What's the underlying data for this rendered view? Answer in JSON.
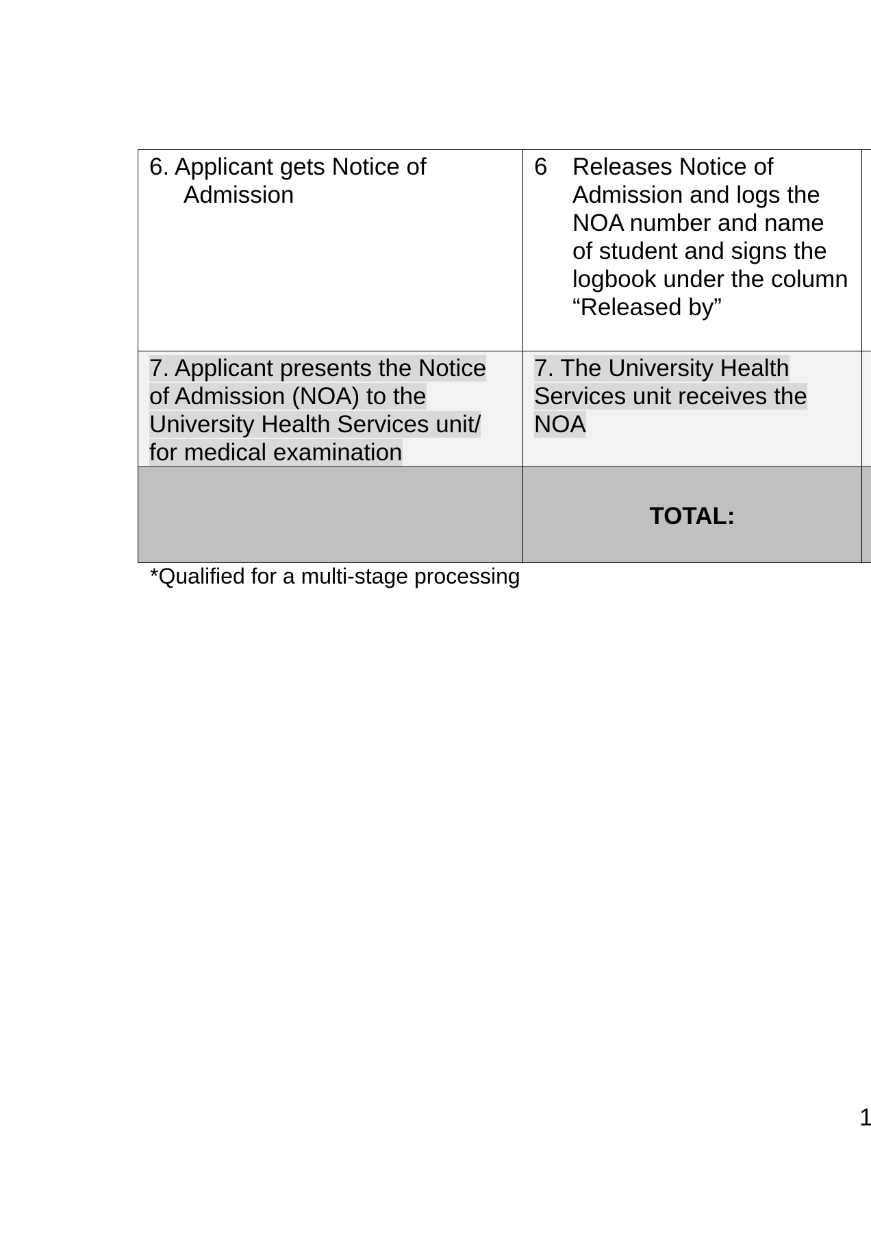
{
  "table": {
    "row6": {
      "col1_num": "6.",
      "col1_text": "Applicant gets Notice of Admission",
      "col2_num": "6",
      "col2_text": "Releases Notice of Admission and logs the NOA number and name of student and signs the logbook under the column “Released by”"
    },
    "row7": {
      "col1_text": "7. Applicant presents the Notice of Admission (NOA) to the University Health Services unit/ for medical examination",
      "col2_text": "7. The University Health Services unit receives the NOA"
    },
    "total_label": "TOTAL:"
  },
  "footnote": "*Qualified for a multi-stage processing",
  "page_number": "1",
  "colors": {
    "row7_background": "#f2f2f2",
    "text_highlight": "#d9d9d9",
    "total_row_background": "#c0c0c0"
  }
}
